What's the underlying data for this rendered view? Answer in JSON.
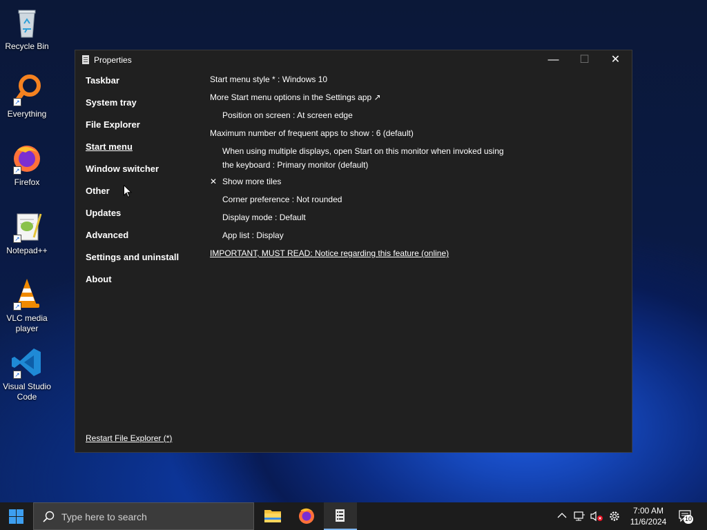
{
  "desktop": {
    "icons": [
      {
        "label": "Recycle Bin",
        "icon": "recycle-bin-icon"
      },
      {
        "label": "Everything",
        "icon": "everything-icon"
      },
      {
        "label": "Firefox",
        "icon": "firefox-icon"
      },
      {
        "label": "Notepad++",
        "icon": "notepad-plus-plus-icon"
      },
      {
        "label": "VLC media player",
        "icon": "vlc-icon"
      },
      {
        "label": "Visual Studio Code",
        "icon": "vscode-icon"
      }
    ]
  },
  "window": {
    "title": "Properties",
    "controls": {
      "minimize": "—",
      "maximize": "☐",
      "close": "✕"
    },
    "nav": {
      "items": [
        {
          "label": "Taskbar"
        },
        {
          "label": "System tray"
        },
        {
          "label": "File Explorer"
        },
        {
          "label": "Start menu",
          "active": true
        },
        {
          "label": "Window switcher"
        },
        {
          "label": "Other"
        },
        {
          "label": "Updates"
        },
        {
          "label": "Advanced"
        },
        {
          "label": "Settings and uninstall"
        },
        {
          "label": "About"
        }
      ],
      "restart_label": "Restart File Explorer (*)"
    },
    "settings": {
      "start_menu_style": "Start menu style * : Windows 10",
      "more_options": "More Start menu options in the Settings app ↗",
      "position": "Position on screen : At screen edge",
      "frequent_apps": "Maximum number of frequent apps to show : 6 (default)",
      "multi_display_line1": "When using multiple displays, open Start on this monitor when invoked using",
      "multi_display_line2": "the keyboard : Primary monitor (default)",
      "show_more_tiles_check": "✕",
      "show_more_tiles": "Show more tiles",
      "corner_preference": "Corner preference : Not rounded",
      "display_mode": "Display mode : Default",
      "app_list": "App list : Display",
      "important_notice": "IMPORTANT, MUST READ: Notice regarding this feature (online)"
    }
  },
  "taskbar": {
    "search_placeholder": "Type here to search",
    "pinned_apps": [
      "file-explorer-icon",
      "firefox-icon",
      "properties-app-icon"
    ],
    "tray": {
      "chevron": "^",
      "time": "7:00 AM",
      "date": "11/6/2024",
      "notification_count": "10"
    }
  },
  "colors": {
    "window_bg": "#202020",
    "taskbar_bg": "#1c1c1c",
    "accent": "#3d9ff0"
  }
}
